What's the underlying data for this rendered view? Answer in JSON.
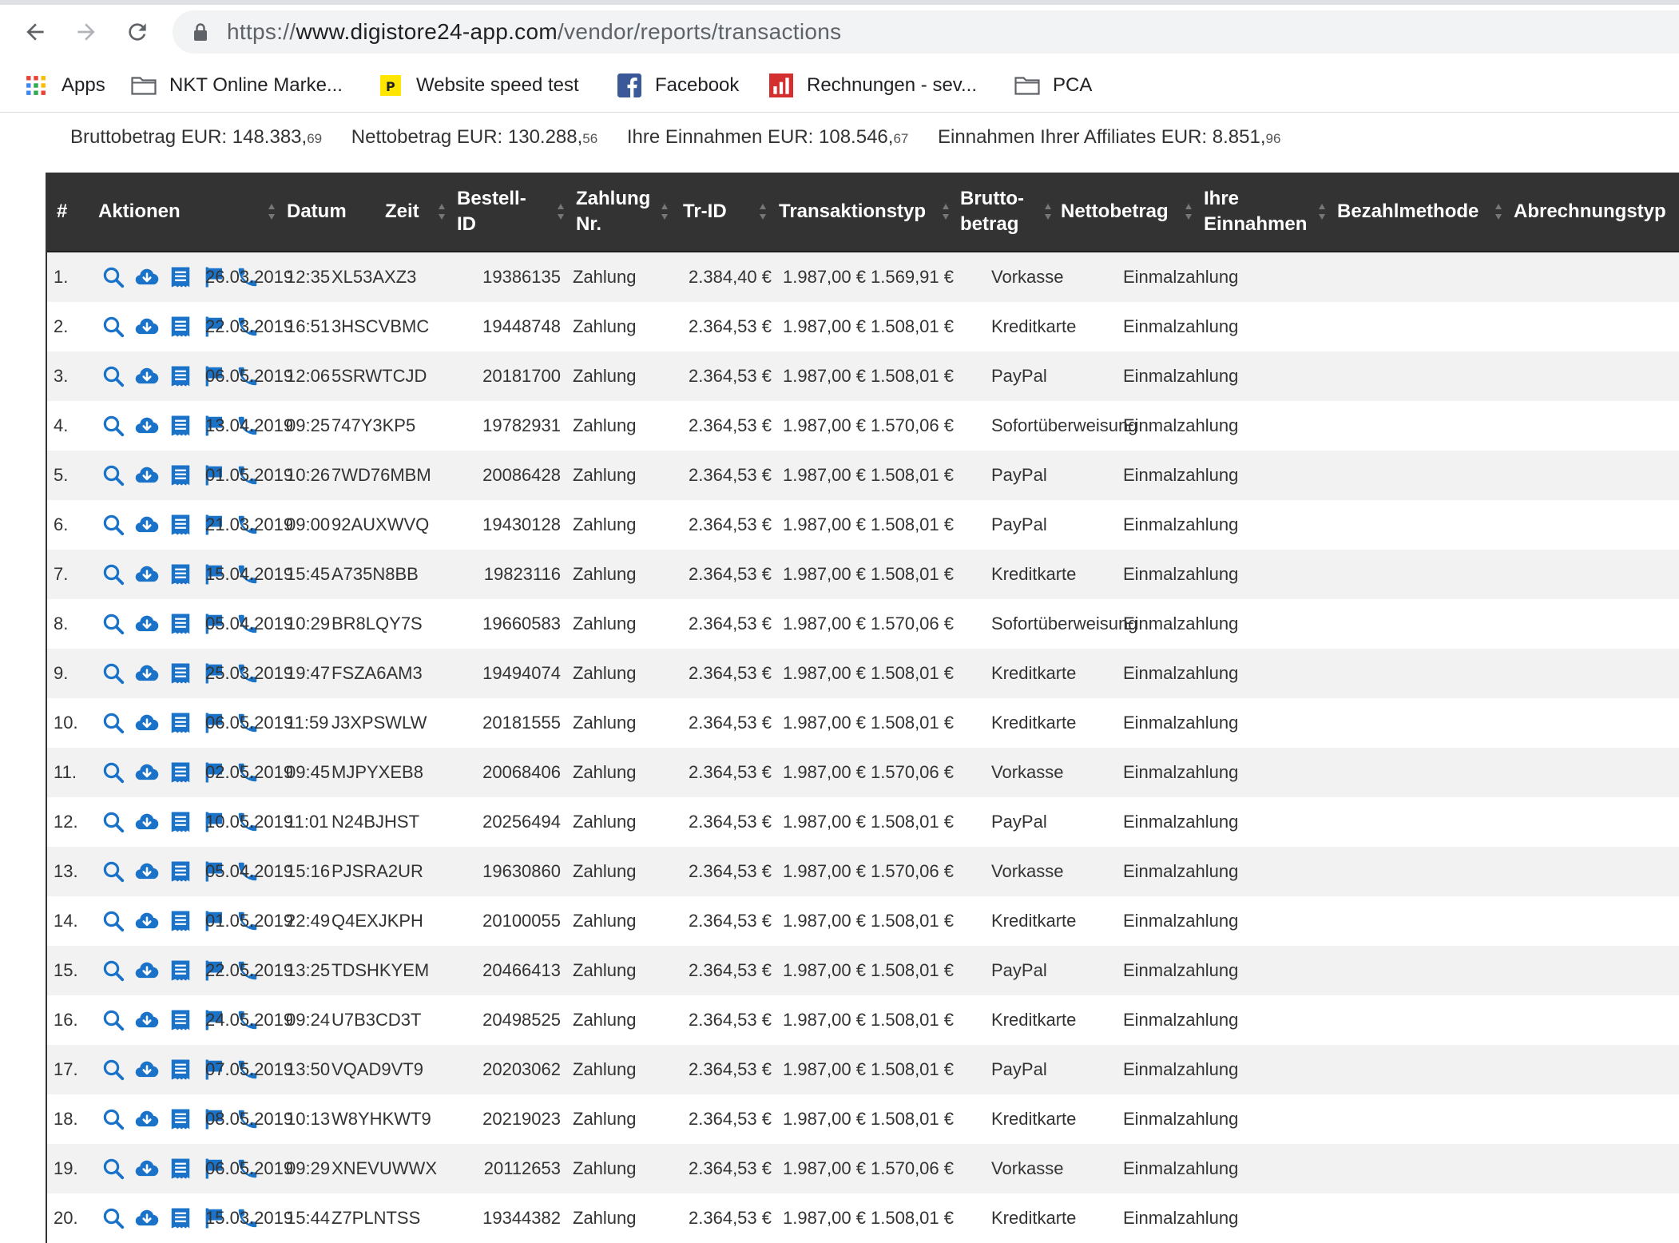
{
  "browser": {
    "url_prefix": "https://",
    "url_host": "www.digistore24-app.com",
    "url_path": "/vendor/reports/transactions",
    "bookmarks": [
      {
        "label": "Apps",
        "icon": "apps-grid-icon"
      },
      {
        "label": "NKT Online Marke...",
        "icon": "folder-icon"
      },
      {
        "label": "Website speed test",
        "icon": "pagespeed-icon"
      },
      {
        "label": "Facebook",
        "icon": "facebook-icon"
      },
      {
        "label": "Rechnungen - sev...",
        "icon": "chart-bars-icon"
      },
      {
        "label": "PCA",
        "icon": "folder-icon"
      }
    ]
  },
  "summary": {
    "brutto_label": "Bruttobetrag EUR: ",
    "brutto_int": "148.383,",
    "brutto_dec": "69",
    "netto_label": "Nettobetrag EUR: ",
    "netto_int": "130.288,",
    "netto_dec": "56",
    "einnahmen_label": "Ihre Einnahmen EUR: ",
    "einnahmen_int": "108.546,",
    "einnahmen_dec": "67",
    "affiliates_label": "Einnahmen Ihrer Affiliates EUR: ",
    "affiliates_int": "8.851,",
    "affiliates_dec": "96"
  },
  "table": {
    "headers": {
      "num": "#",
      "actions": "Aktionen",
      "datum": "Datum",
      "zeit": "Zeit",
      "bestell_1": "Bestell-",
      "bestell_2": "ID",
      "zahlung_1": "Zahlung",
      "zahlung_2": "Nr.",
      "trid": "Tr-ID",
      "typ": "Transaktionstyp",
      "brutto_1": "Brutto-",
      "brutto_2": "betrag",
      "netto": "Nettobetrag",
      "einnahmen_1": "Ihre",
      "einnahmen_2": "Einnahmen",
      "methode": "Bezahlmethode",
      "abrechnung": "Abrechnungstyp"
    },
    "action_icons": [
      "search-icon",
      "download-cloud-icon",
      "invoice-icon",
      "flag-icon",
      "phone-icon"
    ],
    "colors": {
      "header_bg": "#333333",
      "icon_blue": "#1a73c8",
      "row_alt": "#f2f2f2"
    },
    "rows": [
      {
        "num": "1.",
        "datum": "26.03.2019",
        "zeit": "12:35",
        "bestell": "XL53AXZ3",
        "zahlung": "",
        "trid": "19386135",
        "typ": "Zahlung",
        "brutto": "2.384,40 €",
        "netto": "1.987,00 €",
        "einnahmen": "1.569,91 €",
        "methode": "Vorkasse",
        "abrechnung": "Einmalzahlung"
      },
      {
        "num": "2.",
        "datum": "22.03.2019",
        "zeit": "16:51",
        "bestell": "3HSCVBMC",
        "zahlung": "",
        "trid": "19448748",
        "typ": "Zahlung",
        "brutto": "2.364,53 €",
        "netto": "1.987,00 €",
        "einnahmen": "1.508,01 €",
        "methode": "Kreditkarte",
        "abrechnung": "Einmalzahlung"
      },
      {
        "num": "3.",
        "datum": "06.05.2019",
        "zeit": "12:06",
        "bestell": "5SRWTCJD",
        "zahlung": "",
        "trid": "20181700",
        "typ": "Zahlung",
        "brutto": "2.364,53 €",
        "netto": "1.987,00 €",
        "einnahmen": "1.508,01 €",
        "methode": "PayPal",
        "abrechnung": "Einmalzahlung"
      },
      {
        "num": "4.",
        "datum": "13.04.2019",
        "zeit": "09:25",
        "bestell": "747Y3KP5",
        "zahlung": "",
        "trid": "19782931",
        "typ": "Zahlung",
        "brutto": "2.364,53 €",
        "netto": "1.987,00 €",
        "einnahmen": "1.570,06 €",
        "methode": "Sofortüberweisung",
        "abrechnung": "Einmalzahlung"
      },
      {
        "num": "5.",
        "datum": "01.05.2019",
        "zeit": "10:26",
        "bestell": "7WD76MBM",
        "zahlung": "",
        "trid": "20086428",
        "typ": "Zahlung",
        "brutto": "2.364,53 €",
        "netto": "1.987,00 €",
        "einnahmen": "1.508,01 €",
        "methode": "PayPal",
        "abrechnung": "Einmalzahlung"
      },
      {
        "num": "6.",
        "datum": "21.03.2019",
        "zeit": "09:00",
        "bestell": "92AUXWVQ",
        "zahlung": "",
        "trid": "19430128",
        "typ": "Zahlung",
        "brutto": "2.364,53 €",
        "netto": "1.987,00 €",
        "einnahmen": "1.508,01 €",
        "methode": "PayPal",
        "abrechnung": "Einmalzahlung"
      },
      {
        "num": "7.",
        "datum": "15.04.2019",
        "zeit": "15:45",
        "bestell": "A735N8BB",
        "zahlung": "",
        "trid": "19823116",
        "typ": "Zahlung",
        "brutto": "2.364,53 €",
        "netto": "1.987,00 €",
        "einnahmen": "1.508,01 €",
        "methode": "Kreditkarte",
        "abrechnung": "Einmalzahlung"
      },
      {
        "num": "8.",
        "datum": "05.04.2019",
        "zeit": "10:29",
        "bestell": "BR8LQY7S",
        "zahlung": "",
        "trid": "19660583",
        "typ": "Zahlung",
        "brutto": "2.364,53 €",
        "netto": "1.987,00 €",
        "einnahmen": "1.570,06 €",
        "methode": "Sofortüberweisung",
        "abrechnung": "Einmalzahlung"
      },
      {
        "num": "9.",
        "datum": "25.03.2019",
        "zeit": "19:47",
        "bestell": "FSZA6AM3",
        "zahlung": "",
        "trid": "19494074",
        "typ": "Zahlung",
        "brutto": "2.364,53 €",
        "netto": "1.987,00 €",
        "einnahmen": "1.508,01 €",
        "methode": "Kreditkarte",
        "abrechnung": "Einmalzahlung"
      },
      {
        "num": "10.",
        "datum": "06.05.2019",
        "zeit": "11:59",
        "bestell": "J3XPSWLW",
        "zahlung": "",
        "trid": "20181555",
        "typ": "Zahlung",
        "brutto": "2.364,53 €",
        "netto": "1.987,00 €",
        "einnahmen": "1.508,01 €",
        "methode": "Kreditkarte",
        "abrechnung": "Einmalzahlung"
      },
      {
        "num": "11.",
        "datum": "02.05.2019",
        "zeit": "09:45",
        "bestell": "MJPYXEB8",
        "zahlung": "",
        "trid": "20068406",
        "typ": "Zahlung",
        "brutto": "2.364,53 €",
        "netto": "1.987,00 €",
        "einnahmen": "1.570,06 €",
        "methode": "Vorkasse",
        "abrechnung": "Einmalzahlung"
      },
      {
        "num": "12.",
        "datum": "10.05.2019",
        "zeit": "11:01",
        "bestell": "N24BJHST",
        "zahlung": "",
        "trid": "20256494",
        "typ": "Zahlung",
        "brutto": "2.364,53 €",
        "netto": "1.987,00 €",
        "einnahmen": "1.508,01 €",
        "methode": "PayPal",
        "abrechnung": "Einmalzahlung"
      },
      {
        "num": "13.",
        "datum": "05.04.2019",
        "zeit": "15:16",
        "bestell": "PJSRA2UR",
        "zahlung": "",
        "trid": "19630860",
        "typ": "Zahlung",
        "brutto": "2.364,53 €",
        "netto": "1.987,00 €",
        "einnahmen": "1.570,06 €",
        "methode": "Vorkasse",
        "abrechnung": "Einmalzahlung"
      },
      {
        "num": "14.",
        "datum": "01.05.2019",
        "zeit": "22:49",
        "bestell": "Q4EXJKPH",
        "zahlung": "",
        "trid": "20100055",
        "typ": "Zahlung",
        "brutto": "2.364,53 €",
        "netto": "1.987,00 €",
        "einnahmen": "1.508,01 €",
        "methode": "Kreditkarte",
        "abrechnung": "Einmalzahlung"
      },
      {
        "num": "15.",
        "datum": "22.05.2019",
        "zeit": "13:25",
        "bestell": "TDSHKYEM",
        "zahlung": "",
        "trid": "20466413",
        "typ": "Zahlung",
        "brutto": "2.364,53 €",
        "netto": "1.987,00 €",
        "einnahmen": "1.508,01 €",
        "methode": "PayPal",
        "abrechnung": "Einmalzahlung"
      },
      {
        "num": "16.",
        "datum": "24.05.2019",
        "zeit": "09:24",
        "bestell": "U7B3CD3T",
        "zahlung": "",
        "trid": "20498525",
        "typ": "Zahlung",
        "brutto": "2.364,53 €",
        "netto": "1.987,00 €",
        "einnahmen": "1.508,01 €",
        "methode": "Kreditkarte",
        "abrechnung": "Einmalzahlung"
      },
      {
        "num": "17.",
        "datum": "07.05.2019",
        "zeit": "13:50",
        "bestell": "VQAD9VT9",
        "zahlung": "",
        "trid": "20203062",
        "typ": "Zahlung",
        "brutto": "2.364,53 €",
        "netto": "1.987,00 €",
        "einnahmen": "1.508,01 €",
        "methode": "PayPal",
        "abrechnung": "Einmalzahlung"
      },
      {
        "num": "18.",
        "datum": "08.05.2019",
        "zeit": "10:13",
        "bestell": "W8YHKWT9",
        "zahlung": "",
        "trid": "20219023",
        "typ": "Zahlung",
        "brutto": "2.364,53 €",
        "netto": "1.987,00 €",
        "einnahmen": "1.508,01 €",
        "methode": "Kreditkarte",
        "abrechnung": "Einmalzahlung"
      },
      {
        "num": "19.",
        "datum": "06.05.2019",
        "zeit": "09:29",
        "bestell": "XNEVUWWX",
        "zahlung": "",
        "trid": "20112653",
        "typ": "Zahlung",
        "brutto": "2.364,53 €",
        "netto": "1.987,00 €",
        "einnahmen": "1.570,06 €",
        "methode": "Vorkasse",
        "abrechnung": "Einmalzahlung"
      },
      {
        "num": "20.",
        "datum": "15.03.2019",
        "zeit": "15:44",
        "bestell": "Z7PLNTSS",
        "zahlung": "",
        "trid": "19344382",
        "typ": "Zahlung",
        "brutto": "2.364,53 €",
        "netto": "1.987,00 €",
        "einnahmen": "1.508,01 €",
        "methode": "Kreditkarte",
        "abrechnung": "Einmalzahlung"
      }
    ]
  }
}
